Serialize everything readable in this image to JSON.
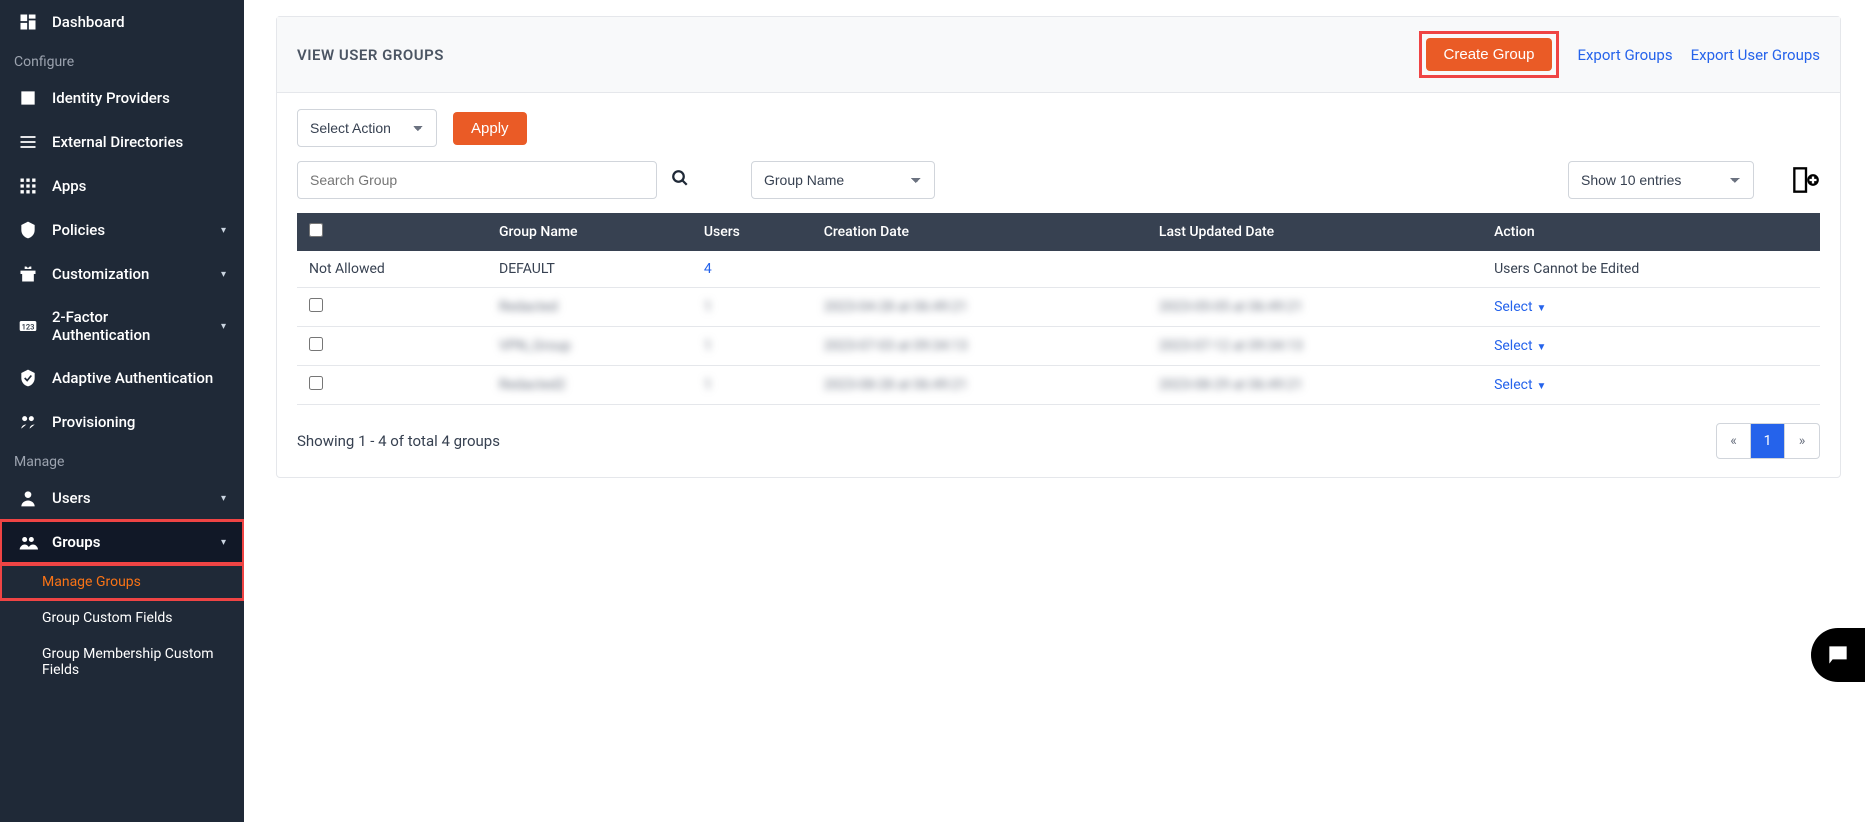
{
  "sidebar": {
    "items": [
      {
        "label": "Dashboard"
      },
      {
        "label": "Identity Providers"
      },
      {
        "label": "External Directories"
      },
      {
        "label": "Apps"
      },
      {
        "label": "Policies"
      },
      {
        "label": "Customization"
      },
      {
        "label": "2-Factor Authentication"
      },
      {
        "label": "Adaptive Authentication"
      },
      {
        "label": "Provisioning"
      },
      {
        "label": "Users"
      },
      {
        "label": "Groups"
      }
    ],
    "section_configure": "Configure",
    "section_manage": "Manage",
    "subitems": {
      "manage_groups": "Manage Groups",
      "group_custom_fields": "Group Custom Fields",
      "group_membership_custom_fields": "Group Membership Custom Fields"
    }
  },
  "header": {
    "title": "VIEW USER GROUPS",
    "create_group": "Create Group",
    "export_groups": "Export Groups",
    "export_user_groups": "Export User Groups"
  },
  "controls": {
    "select_action": "Select Action",
    "apply": "Apply",
    "search_placeholder": "Search Group",
    "filter": "Group Name",
    "entries": "Show 10 entries"
  },
  "table": {
    "columns": {
      "group_name": "Group Name",
      "users": "Users",
      "creation": "Creation Date",
      "updated": "Last Updated Date",
      "action": "Action"
    },
    "rows": [
      {
        "checkbox_text": "Not Allowed",
        "group_name": "DEFAULT",
        "users": "4",
        "creation": "",
        "updated": "",
        "action_text": "Users Cannot be Edited",
        "default": true
      },
      {
        "group_name": "Redacted",
        "users": "1",
        "creation": "2023-04-28 at 06:49:21",
        "updated": "2023-05-05 at 06:49:21",
        "action_text": "Select"
      },
      {
        "group_name": "VPN_Group",
        "users": "1",
        "creation": "2023-07-03 at 09:34:13",
        "updated": "2023-07-12 at 09:34:13",
        "action_text": "Select"
      },
      {
        "group_name": "Redacted2",
        "users": "1",
        "creation": "2023-08-28 at 06:49:21",
        "updated": "2023-08-29 at 06:49:21",
        "action_text": "Select"
      }
    ]
  },
  "footer": {
    "text": "Showing 1 - 4 of total 4 groups",
    "prev": "«",
    "page": "1",
    "next": "»"
  }
}
